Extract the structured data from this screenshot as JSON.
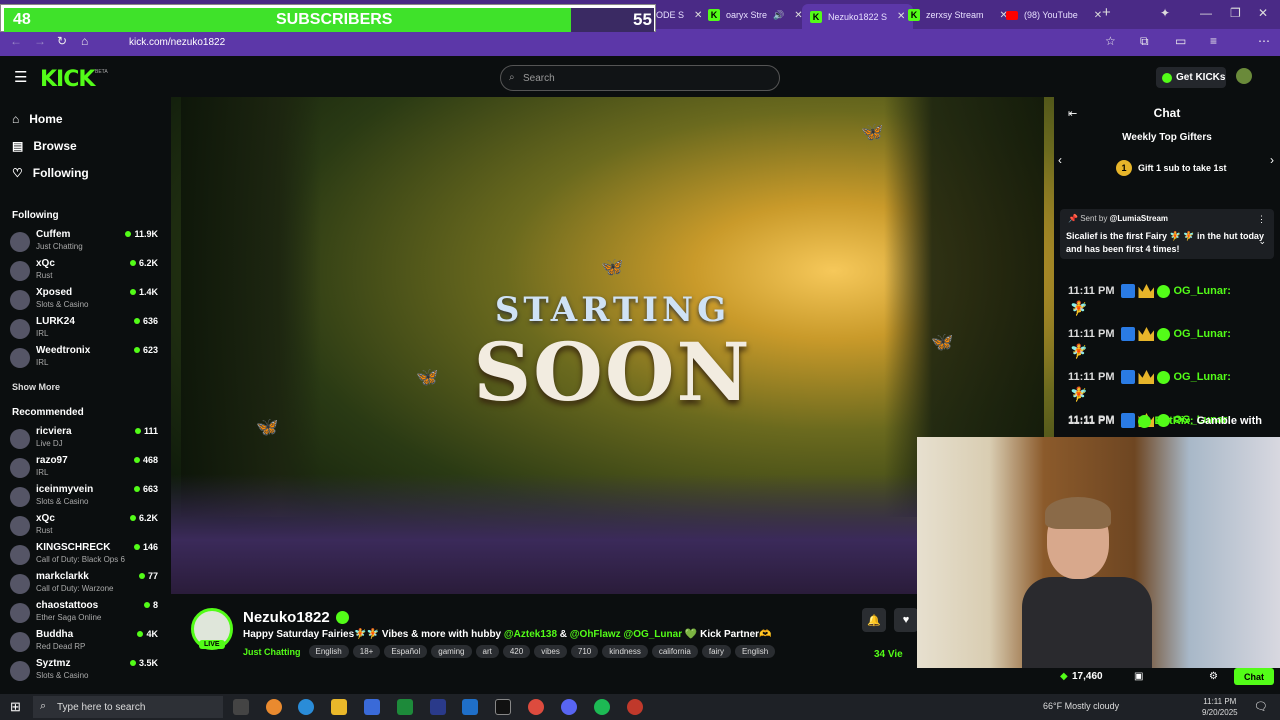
{
  "subs_overlay": {
    "left": "48",
    "label": "SUBSCRIBERS",
    "right": "55"
  },
  "tabs": [
    {
      "label": "SPIRICODE S",
      "icon": "kick-icon"
    },
    {
      "label": "oaryx Stre",
      "icon": "kick-icon"
    },
    {
      "label": "Nezuko1822 S",
      "icon": "kick-icon",
      "active": true
    },
    {
      "label": "zerxsy Stream",
      "icon": "kick-icon"
    },
    {
      "label": "(98) YouTube",
      "icon": "youtube-icon"
    }
  ],
  "address": "kick.com/nezuko1822",
  "header": {
    "logo": "KICK",
    "beta": "BETA",
    "search_placeholder": "Search",
    "get_kicks": "Get KICKs"
  },
  "nav": [
    {
      "label": "Home",
      "icon": "home-icon"
    },
    {
      "label": "Browse",
      "icon": "browse-icon"
    },
    {
      "label": "Following",
      "icon": "heart-icon"
    }
  ],
  "following_title": "Following",
  "following": [
    {
      "name": "Cuffem",
      "category": "Just Chatting",
      "viewers": "11.9K"
    },
    {
      "name": "xQc",
      "category": "Rust",
      "viewers": "6.2K"
    },
    {
      "name": "Xposed",
      "category": "Slots & Casino",
      "viewers": "1.4K"
    },
    {
      "name": "LURK24",
      "category": "IRL",
      "viewers": "636"
    },
    {
      "name": "Weedtronix",
      "category": "IRL",
      "viewers": "623"
    }
  ],
  "show_more": "Show More",
  "recommended_title": "Recommended",
  "recommended": [
    {
      "name": "ricviera",
      "category": "Live DJ",
      "viewers": "111"
    },
    {
      "name": "razo97",
      "category": "IRL",
      "viewers": "468"
    },
    {
      "name": "iceinmyvein",
      "category": "Slots & Casino",
      "viewers": "663"
    },
    {
      "name": "xQc",
      "category": "Rust",
      "viewers": "6.2K"
    },
    {
      "name": "KINGSCHRECK",
      "category": "Call of Duty: Black Ops 6",
      "viewers": "146"
    },
    {
      "name": "markclarkk",
      "category": "Call of Duty: Warzone",
      "viewers": "77"
    },
    {
      "name": "chaostattoos",
      "category": "Ether Saga Online",
      "viewers": "8"
    },
    {
      "name": "Buddha",
      "category": "Red Dead RP",
      "viewers": "4K"
    },
    {
      "name": "Syztmz",
      "category": "Slots & Casino",
      "viewers": "3.5K"
    }
  ],
  "video": {
    "line1": "STARTING",
    "line2": "SOON"
  },
  "stream": {
    "channel": "Nezuko1822",
    "live": "LIVE",
    "title_a": "Happy Saturday Fairies🧚🧚 Vibes & more with hubby ",
    "title_b": "@Aztek138",
    "title_c": " & ",
    "title_d": "@OhFlawz @OG_Lunar",
    "title_e": " 💚 Kick Partner🫶",
    "category": "Just Chatting",
    "tags": [
      "English",
      "18+",
      "Español",
      "gaming",
      "art",
      "420",
      "vibes",
      "710",
      "kindness",
      "california",
      "fairy",
      "English"
    ],
    "viewers": "34 Vie"
  },
  "chat": {
    "title": "Chat",
    "weekly": "Weekly Top Gifters",
    "gift": "Gift 1 sub to take 1st",
    "gift_rank": "1",
    "pinned_by_pre": "Sent by",
    "pinned_by": "@LumiaStream",
    "pinned_msg": "Sicalief is the first Fairy 🧚 🧚 in the hut today and has been first 4 times!",
    "messages": [
      {
        "time": "11:11 PM",
        "user": "OG_Lunar:"
      },
      {
        "time": "11:11 PM",
        "user": "OG_Lunar:"
      },
      {
        "time": "11:11 PM",
        "user": "OG_Lunar:"
      },
      {
        "time": "11:11 PM",
        "user": "OG_Lunar:"
      },
      {
        "time": "11:11 PM",
        "user": "BotRix:",
        "text": "Gamble with"
      }
    ],
    "kicks_count": "17,460",
    "chat_button": "Chat"
  },
  "taskbar": {
    "search": "Type here to search",
    "weather": "66°F  Mostly cloudy",
    "time": "11:11 PM",
    "date": "9/20/2025"
  }
}
